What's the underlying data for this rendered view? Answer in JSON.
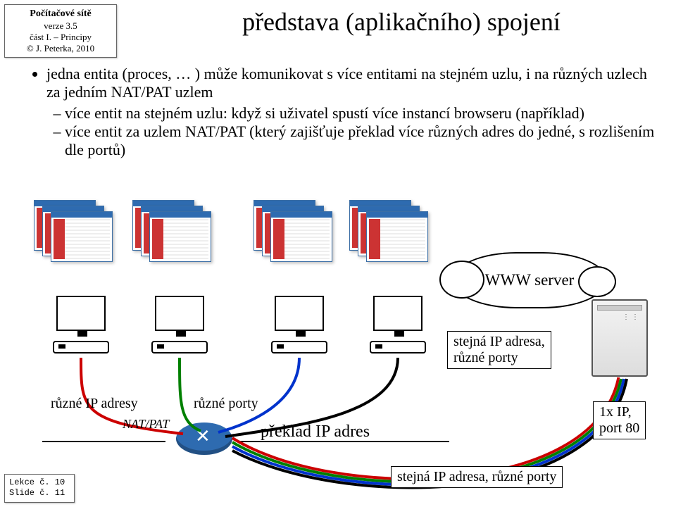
{
  "header": {
    "line1": "Počítačové sítě",
    "line2": "verze 3.5",
    "line3": "část I. – Principy",
    "line4": "© J. Peterka, 2010"
  },
  "title": "představa (aplikačního) spojení",
  "bullets": {
    "b1": "jedna entita (proces, … ) může komunikovat s více entitami na stejném uzlu, i na různých uzlech za jedním NAT/PAT uzlem",
    "b1a": "více entit na stejném uzlu: když si uživatel spustí více instancí browseru (například)",
    "b1b": "více entit za uzlem NAT/PAT (který zajišťuje překlad více různých adres do jedné, s rozlišením dle portů)"
  },
  "labels": {
    "cloud": "WWW server",
    "same_ip_ports_box": "stejná IP adresa,\nrůzné porty",
    "same_ip_ports_line": "stejná IP adresa, různé porty",
    "diff_ip": "různé IP adresy",
    "diff_ports": "různé porty",
    "natpat": "NAT/PAT",
    "translate": "překlad IP adres",
    "one_ip": "1x IP,\nport 80"
  },
  "footer": {
    "l1": "Lekce č. 10",
    "l2": "Slide č. 11"
  }
}
